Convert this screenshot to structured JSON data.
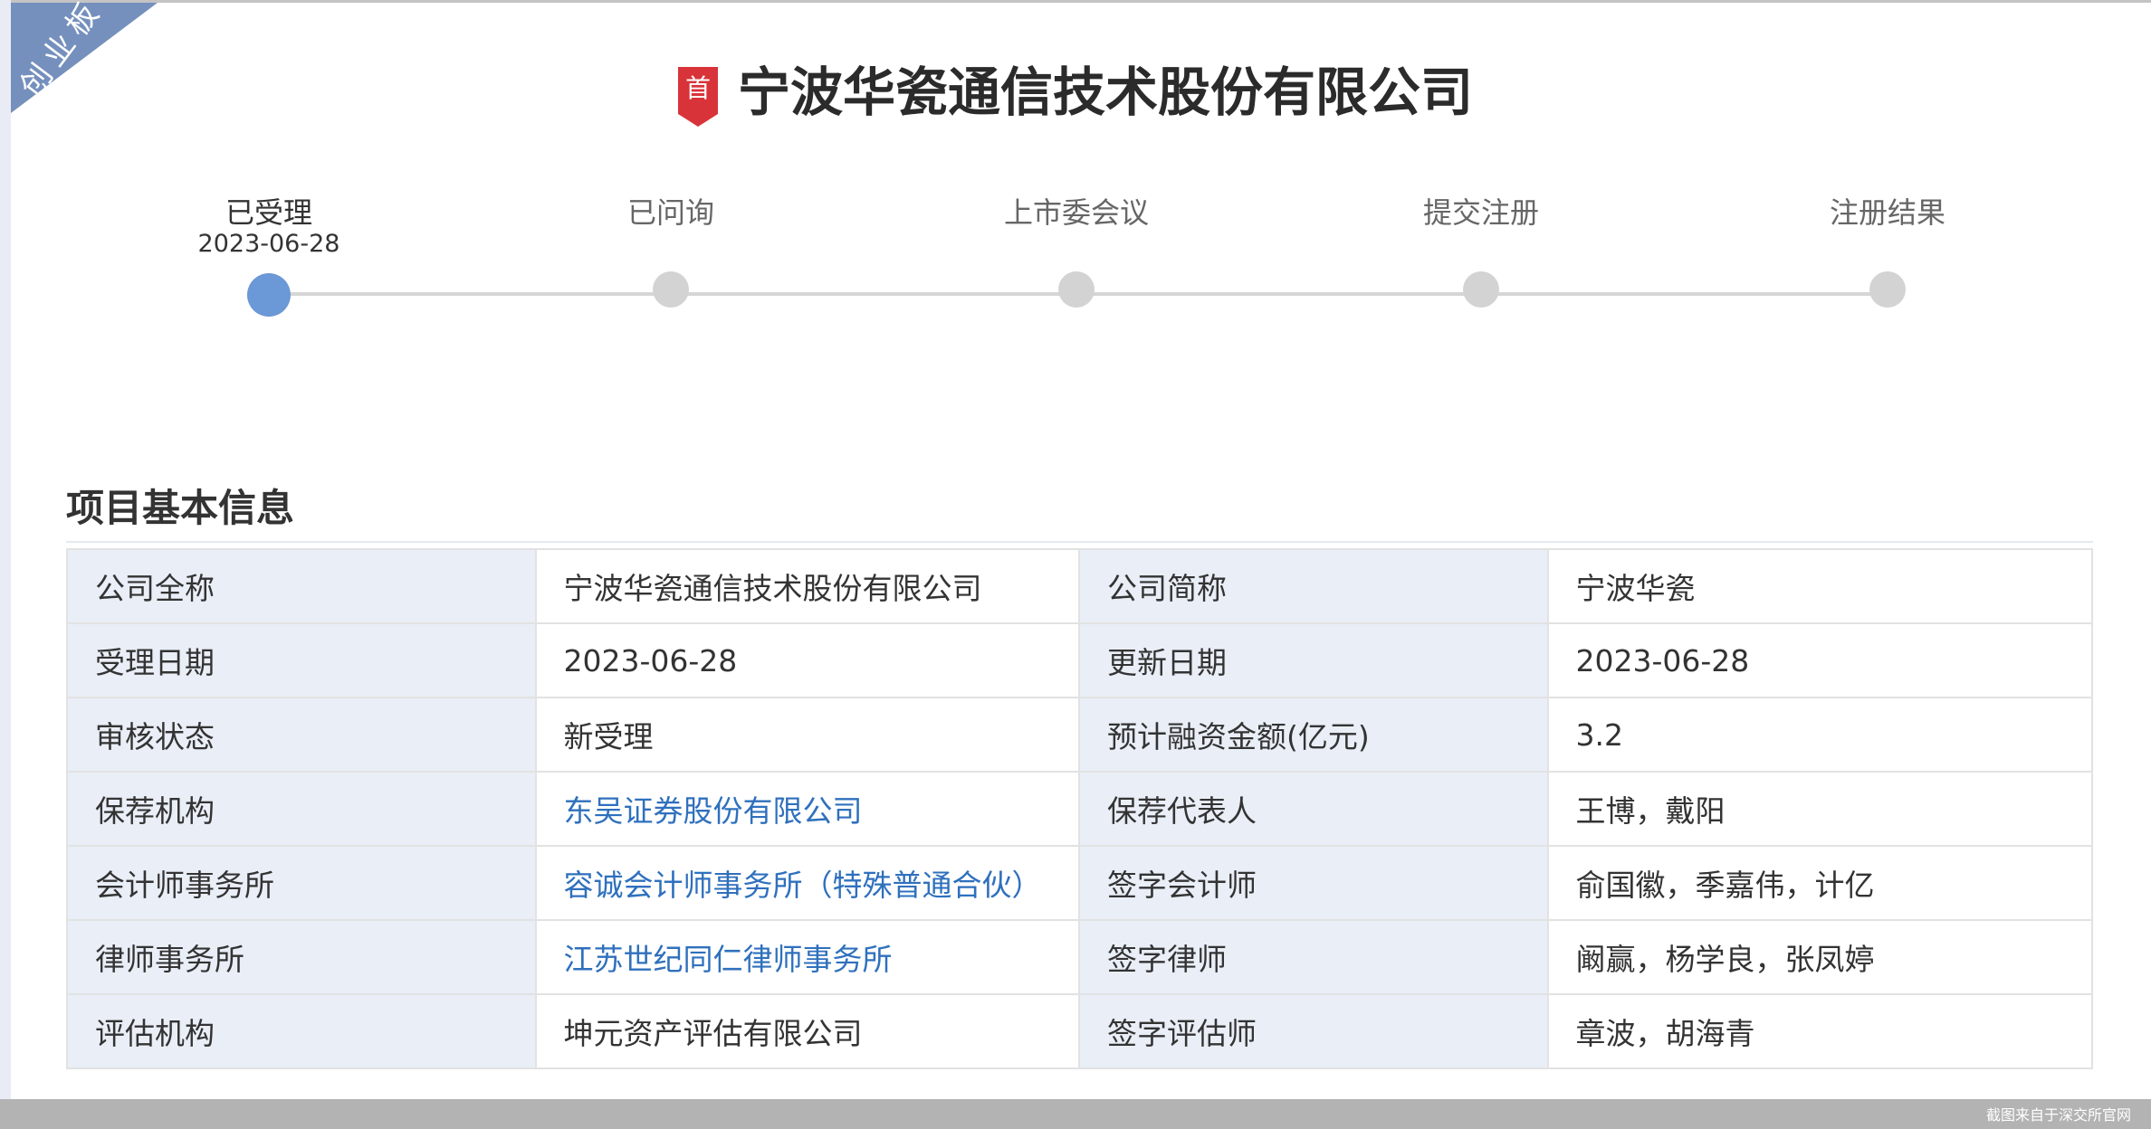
{
  "board": "创业板",
  "header": {
    "badge": "首",
    "title": "宁波华瓷通信技术股份有限公司"
  },
  "steps": [
    {
      "label": "已受理",
      "date": "2023-06-28",
      "active": true
    },
    {
      "label": "已问询"
    },
    {
      "label": "上市委会议"
    },
    {
      "label": "提交注册"
    },
    {
      "label": "注册结果"
    }
  ],
  "section_title": "项目基本信息",
  "rows": [
    {
      "k1": "公司全称",
      "v1": "宁波华瓷通信技术股份有限公司",
      "k2": "公司简称",
      "v2": "宁波华瓷"
    },
    {
      "k1": "受理日期",
      "v1": "2023-06-28",
      "k2": "更新日期",
      "v2": "2023-06-28"
    },
    {
      "k1": "审核状态",
      "v1": "新受理",
      "k2": "预计融资金额(亿元)",
      "v2": "3.2"
    },
    {
      "k1": "保荐机构",
      "v1": "东吴证券股份有限公司",
      "k2": "保荐代表人",
      "v2": "王博，戴阳"
    },
    {
      "k1": "会计师事务所",
      "v1": "容诚会计师事务所（特殊普通合伙）",
      "k2": "签字会计师",
      "v2": "俞国徽，季嘉伟，计亿"
    },
    {
      "k1": "律师事务所",
      "v1": "江苏世纪同仁律师事务所",
      "k2": "签字律师",
      "v2": "阚赢，杨学良，张凤婷"
    },
    {
      "k1": "评估机构",
      "v1": "坤元资产评估有限公司",
      "k2": "签字评估师",
      "v2": "章波，胡海青"
    }
  ],
  "footer": {
    "watermark": "截图来自于深交所官网"
  }
}
